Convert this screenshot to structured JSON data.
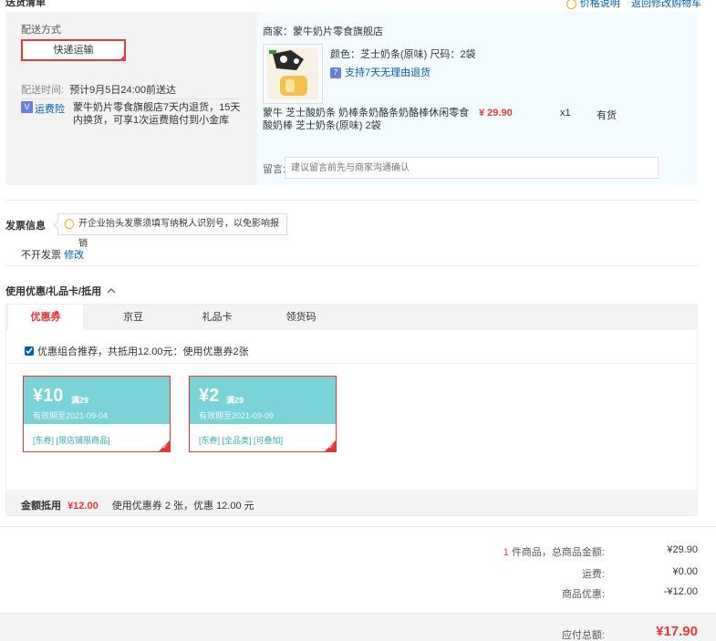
{
  "top": {
    "section_title": "送货清单",
    "link1": "价格说明",
    "link2": "返回修改购物车"
  },
  "shipping": {
    "label": "配送方式",
    "method": "快递运输",
    "time_label": "配送时间:",
    "time_value": "预计9月5日24:00前送达",
    "insurance_badge": "V",
    "insurance_label": "运费险",
    "insurance_desc": "蒙牛奶片零食旗舰店7天内退货，15天内换货，可享1次运费赔付到小金库"
  },
  "product": {
    "merchant": "商家：蒙牛奶片零食旗舰店",
    "attributes": "颜色：芝士奶条(原味) 尺码：2袋",
    "return_badge": "7",
    "return_policy": "支持7天无理由退货",
    "name": "蒙牛 芝士酸奶条 奶棒条奶酪条奶酪棒休闲零食酸奶棒 芝士奶条(原味) 2袋",
    "price": "¥ 29.90",
    "qty": "x1",
    "stock": "有货",
    "memo_label": "留言:",
    "memo_placeholder": "建议留言前先与商家沟通确认"
  },
  "invoice": {
    "title": "发票信息",
    "tip": "开企业抬头发票须填写纳税人识别号，以免影响报销",
    "value": "不开发票",
    "edit": "修改"
  },
  "coupons": {
    "title": "使用优惠/礼品卡/抵用",
    "tabs": [
      "优惠券",
      "京豆",
      "礼品卡",
      "领货码"
    ],
    "combo_text": "优惠组合推荐，共抵用12.00元：使用优惠券2张",
    "items": [
      {
        "amount": "¥10",
        "cond": "满29",
        "valid": "有效期至2021-09-04",
        "tags": "[东券] [限店铺限商品]"
      },
      {
        "amount": "¥2",
        "cond": "满29",
        "valid": "有效期至2021-09-09",
        "tags": "[东券] [全品类] [可叠加]"
      }
    ],
    "deduct_label": "金额抵用",
    "deduct_amount": "¥12.00",
    "deduct_desc": "使用优惠券 2 张，优惠 12.00 元"
  },
  "summary": {
    "count": "1",
    "goods_label": "件商品，总商品金额:",
    "goods_value": "¥29.90",
    "freight_label": "运费:",
    "freight_value": "¥0.00",
    "discount_label": "商品优惠:",
    "discount_value": "-¥12.00",
    "total_label": "应付总额:",
    "total_value": "¥17.90"
  }
}
